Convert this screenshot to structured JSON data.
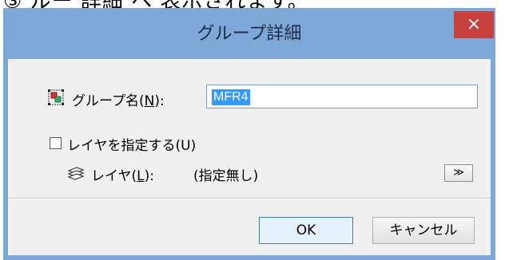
{
  "caption_fragment": "③ ルー 詳細 ヘ 表示されます。",
  "dialog": {
    "title": "グループ詳細",
    "close_glyph": "×"
  },
  "group_name": {
    "icon": "group-icon",
    "label_prefix": "グループ名(",
    "label_key": "N",
    "label_suffix": "):",
    "value": "MFR4"
  },
  "specify_layer": {
    "checked": false,
    "label": "レイヤを指定する(U)"
  },
  "layer": {
    "icon": "layers-icon",
    "label_prefix": "レイヤ(",
    "label_key": "L",
    "label_suffix": "):",
    "value": "(指定無し)",
    "browse_label": "≫"
  },
  "buttons": {
    "ok": "OK",
    "cancel": "キャンセル"
  },
  "colors": {
    "titlebar": "#7ea8d8",
    "close": "#c7413f",
    "selection": "#3399ff",
    "client": "#f0f0f0"
  }
}
